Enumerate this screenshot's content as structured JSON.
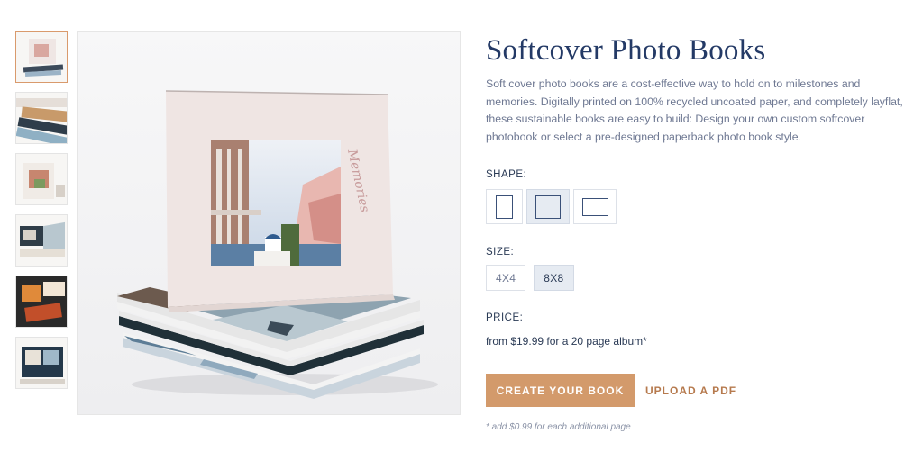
{
  "product": {
    "title": "Softcover Photo Books",
    "description": "Soft cover photo books are a cost-effective way to hold on to milestones and memories. Digitally printed on 100% recycled uncoated paper, and completely layflat, these sustainable books are easy to build: Design your own custom softcover photobook or select a pre-designed paperback photo book style."
  },
  "shape": {
    "label": "SHAPE:",
    "options": [
      "portrait",
      "square",
      "landscape"
    ],
    "selected": "square"
  },
  "size": {
    "label": "SIZE:",
    "options": [
      "4X4",
      "8X8"
    ],
    "selected": "8X8"
  },
  "price": {
    "label": "PRICE:",
    "text": "from $19.99 for a 20 page album*"
  },
  "actions": {
    "create_label": "CREATE YOUR BOOK",
    "upload_label": "UPLOAD A PDF"
  },
  "note": "* add $0.99 for each additional page",
  "cover_script_text": "Memories",
  "colors": {
    "accent": "#d39a6b",
    "upload_text": "#b67a4e",
    "title": "#243a66",
    "selected_bg": "#e6ebf2"
  }
}
